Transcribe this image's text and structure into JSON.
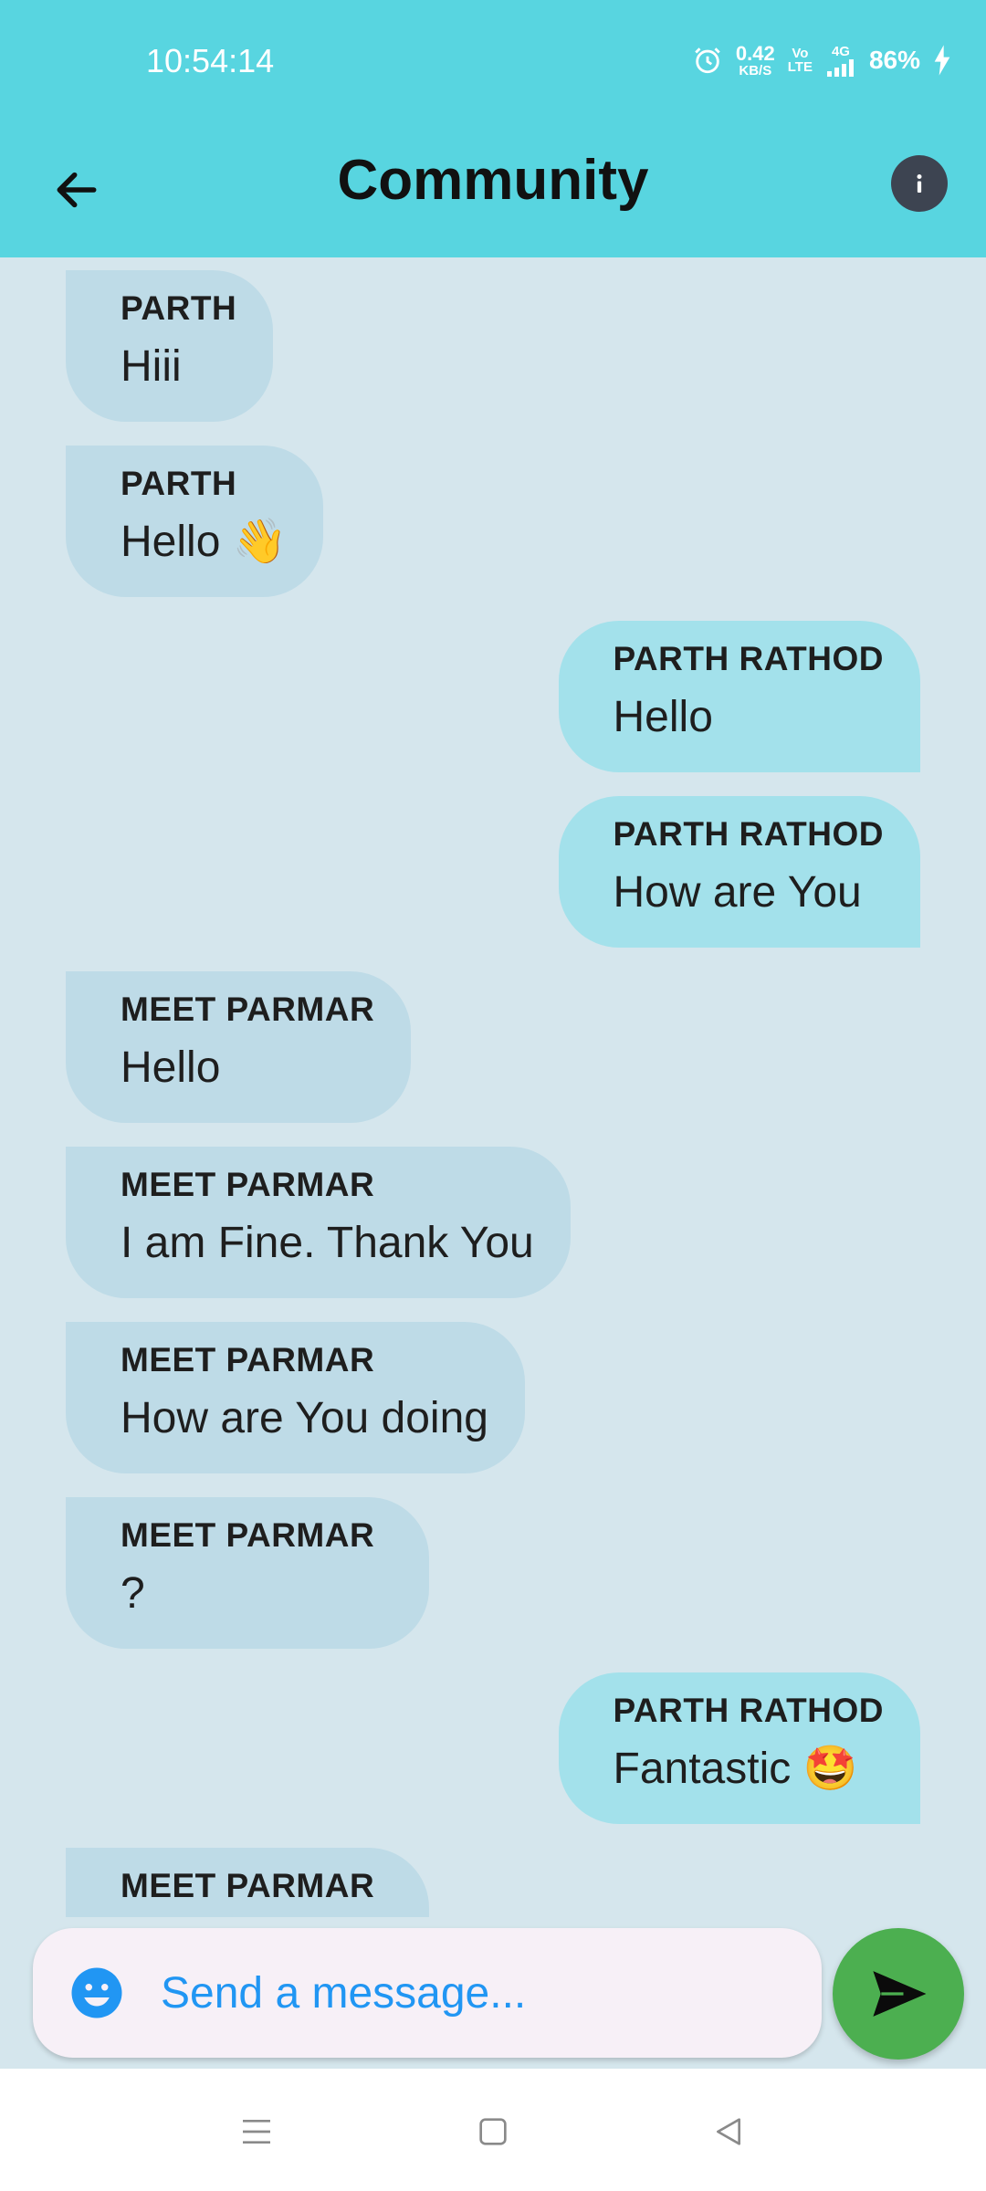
{
  "status_bar": {
    "time": "10:54:14",
    "net_speed": "0.42",
    "net_unit": "KB/S",
    "volte_top": "Vo",
    "volte_bottom": "LTE",
    "network": "4G",
    "battery": "86%"
  },
  "app_bar": {
    "title": "Community"
  },
  "messages": [
    {
      "sender": "PARTH",
      "text": "Hiii",
      "direction": "incoming"
    },
    {
      "sender": "PARTH",
      "text": "Hello 👋",
      "direction": "incoming"
    },
    {
      "sender": "PARTH RATHOD",
      "text": "Hello",
      "direction": "outgoing"
    },
    {
      "sender": "PARTH RATHOD",
      "text": "How are You",
      "direction": "outgoing"
    },
    {
      "sender": "MEET PARMAR",
      "text": "Hello",
      "direction": "incoming"
    },
    {
      "sender": "MEET PARMAR",
      "text": "I am Fine. Thank You",
      "direction": "incoming"
    },
    {
      "sender": "MEET PARMAR",
      "text": "How are You doing",
      "direction": "incoming"
    },
    {
      "sender": "MEET PARMAR",
      "text": "?",
      "direction": "incoming"
    },
    {
      "sender": "PARTH RATHOD",
      "text": "Fantastic 🤩",
      "direction": "outgoing"
    },
    {
      "sender": "MEET PARMAR",
      "text": "",
      "direction": "incoming"
    }
  ],
  "composer": {
    "placeholder": "Send a message..."
  },
  "icons": {
    "back": "arrow-left-icon",
    "info": "info-icon",
    "emoji": "emoji-icon",
    "send": "send-icon",
    "nav_menu": "menu-icon",
    "nav_home": "home-square-icon",
    "nav_back": "back-triangle-icon"
  },
  "colors": {
    "header": "#58d5e0",
    "chat_background": "#d5e6ed",
    "incoming_bubble": "#bedbe7",
    "outgoing_bubble": "#a3e1eb",
    "send_button": "#4caf50",
    "accent_blue": "#2196f3"
  }
}
